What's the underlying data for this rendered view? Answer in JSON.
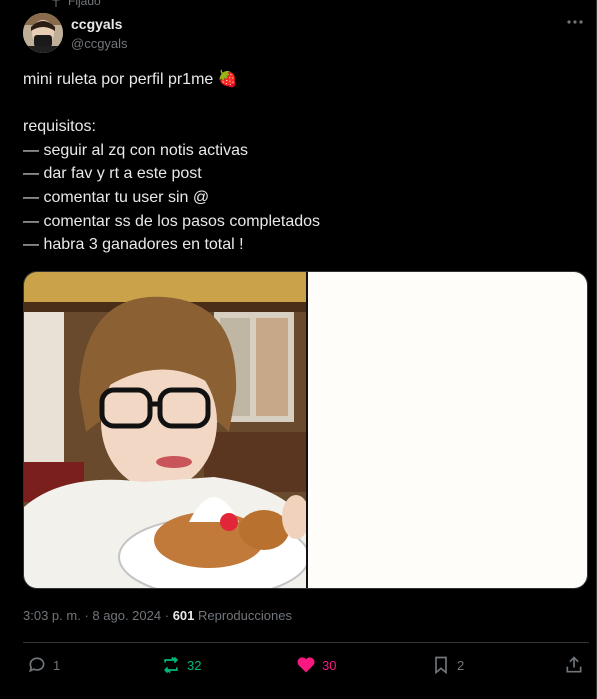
{
  "pinned": {
    "label": "Fijado"
  },
  "author": {
    "display_name": "ccgyals",
    "handle": "@ccgyals"
  },
  "tweet": {
    "lines": [
      "mini ruleta por perfil pr1me 🍓",
      "",
      "requisitos:",
      "— seguir al zq con notis activas",
      "— dar fav y rt a este post",
      "— comentar tu user sin @",
      "— comentar ss de los pasos completados",
      "— habra 3 ganadores en total !"
    ]
  },
  "meta": {
    "time": "3:03 p. m.",
    "dot1": "·",
    "date": "8 ago. 2024",
    "dot2": "·",
    "views": "601",
    "views_label": "Reproducciones"
  },
  "actions": {
    "replies": "1",
    "reposts": "32",
    "likes": "30",
    "bookmarks": "2"
  },
  "colors": {
    "repost": "#00ba7c",
    "like": "#f91880",
    "muted": "#71767b"
  }
}
